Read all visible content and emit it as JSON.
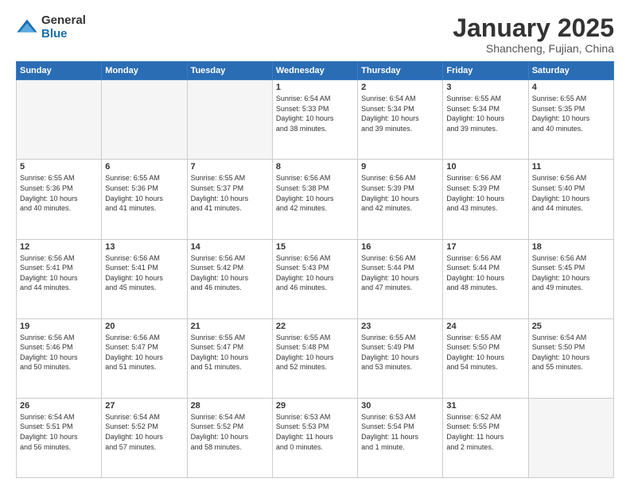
{
  "logo": {
    "general": "General",
    "blue": "Blue"
  },
  "header": {
    "month": "January 2025",
    "location": "Shancheng, Fujian, China"
  },
  "weekdays": [
    "Sunday",
    "Monday",
    "Tuesday",
    "Wednesday",
    "Thursday",
    "Friday",
    "Saturday"
  ],
  "weeks": [
    [
      {
        "day": "",
        "info": ""
      },
      {
        "day": "",
        "info": ""
      },
      {
        "day": "",
        "info": ""
      },
      {
        "day": "1",
        "info": "Sunrise: 6:54 AM\nSunset: 5:33 PM\nDaylight: 10 hours\nand 38 minutes."
      },
      {
        "day": "2",
        "info": "Sunrise: 6:54 AM\nSunset: 5:34 PM\nDaylight: 10 hours\nand 39 minutes."
      },
      {
        "day": "3",
        "info": "Sunrise: 6:55 AM\nSunset: 5:34 PM\nDaylight: 10 hours\nand 39 minutes."
      },
      {
        "day": "4",
        "info": "Sunrise: 6:55 AM\nSunset: 5:35 PM\nDaylight: 10 hours\nand 40 minutes."
      }
    ],
    [
      {
        "day": "5",
        "info": "Sunrise: 6:55 AM\nSunset: 5:36 PM\nDaylight: 10 hours\nand 40 minutes."
      },
      {
        "day": "6",
        "info": "Sunrise: 6:55 AM\nSunset: 5:36 PM\nDaylight: 10 hours\nand 41 minutes."
      },
      {
        "day": "7",
        "info": "Sunrise: 6:55 AM\nSunset: 5:37 PM\nDaylight: 10 hours\nand 41 minutes."
      },
      {
        "day": "8",
        "info": "Sunrise: 6:56 AM\nSunset: 5:38 PM\nDaylight: 10 hours\nand 42 minutes."
      },
      {
        "day": "9",
        "info": "Sunrise: 6:56 AM\nSunset: 5:39 PM\nDaylight: 10 hours\nand 42 minutes."
      },
      {
        "day": "10",
        "info": "Sunrise: 6:56 AM\nSunset: 5:39 PM\nDaylight: 10 hours\nand 43 minutes."
      },
      {
        "day": "11",
        "info": "Sunrise: 6:56 AM\nSunset: 5:40 PM\nDaylight: 10 hours\nand 44 minutes."
      }
    ],
    [
      {
        "day": "12",
        "info": "Sunrise: 6:56 AM\nSunset: 5:41 PM\nDaylight: 10 hours\nand 44 minutes."
      },
      {
        "day": "13",
        "info": "Sunrise: 6:56 AM\nSunset: 5:41 PM\nDaylight: 10 hours\nand 45 minutes."
      },
      {
        "day": "14",
        "info": "Sunrise: 6:56 AM\nSunset: 5:42 PM\nDaylight: 10 hours\nand 46 minutes."
      },
      {
        "day": "15",
        "info": "Sunrise: 6:56 AM\nSunset: 5:43 PM\nDaylight: 10 hours\nand 46 minutes."
      },
      {
        "day": "16",
        "info": "Sunrise: 6:56 AM\nSunset: 5:44 PM\nDaylight: 10 hours\nand 47 minutes."
      },
      {
        "day": "17",
        "info": "Sunrise: 6:56 AM\nSunset: 5:44 PM\nDaylight: 10 hours\nand 48 minutes."
      },
      {
        "day": "18",
        "info": "Sunrise: 6:56 AM\nSunset: 5:45 PM\nDaylight: 10 hours\nand 49 minutes."
      }
    ],
    [
      {
        "day": "19",
        "info": "Sunrise: 6:56 AM\nSunset: 5:46 PM\nDaylight: 10 hours\nand 50 minutes."
      },
      {
        "day": "20",
        "info": "Sunrise: 6:56 AM\nSunset: 5:47 PM\nDaylight: 10 hours\nand 51 minutes."
      },
      {
        "day": "21",
        "info": "Sunrise: 6:55 AM\nSunset: 5:47 PM\nDaylight: 10 hours\nand 51 minutes."
      },
      {
        "day": "22",
        "info": "Sunrise: 6:55 AM\nSunset: 5:48 PM\nDaylight: 10 hours\nand 52 minutes."
      },
      {
        "day": "23",
        "info": "Sunrise: 6:55 AM\nSunset: 5:49 PM\nDaylight: 10 hours\nand 53 minutes."
      },
      {
        "day": "24",
        "info": "Sunrise: 6:55 AM\nSunset: 5:50 PM\nDaylight: 10 hours\nand 54 minutes."
      },
      {
        "day": "25",
        "info": "Sunrise: 6:54 AM\nSunset: 5:50 PM\nDaylight: 10 hours\nand 55 minutes."
      }
    ],
    [
      {
        "day": "26",
        "info": "Sunrise: 6:54 AM\nSunset: 5:51 PM\nDaylight: 10 hours\nand 56 minutes."
      },
      {
        "day": "27",
        "info": "Sunrise: 6:54 AM\nSunset: 5:52 PM\nDaylight: 10 hours\nand 57 minutes."
      },
      {
        "day": "28",
        "info": "Sunrise: 6:54 AM\nSunset: 5:52 PM\nDaylight: 10 hours\nand 58 minutes."
      },
      {
        "day": "29",
        "info": "Sunrise: 6:53 AM\nSunset: 5:53 PM\nDaylight: 11 hours\nand 0 minutes."
      },
      {
        "day": "30",
        "info": "Sunrise: 6:53 AM\nSunset: 5:54 PM\nDaylight: 11 hours\nand 1 minute."
      },
      {
        "day": "31",
        "info": "Sunrise: 6:52 AM\nSunset: 5:55 PM\nDaylight: 11 hours\nand 2 minutes."
      },
      {
        "day": "",
        "info": ""
      }
    ]
  ]
}
